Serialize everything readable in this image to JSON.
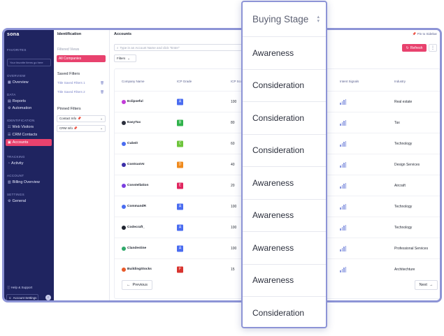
{
  "sidebar": {
    "logo": "sona",
    "sections": {
      "favorites": "FAVORITES",
      "overview": "OVERVIEW",
      "data": "DATA",
      "identification": "IDENTIFICATION",
      "tracking": "TRACKING",
      "account": "ACCOUNT",
      "settings": "SETTINGS"
    },
    "favorites_placeholder": "Your favorite items go here",
    "items": {
      "overview": "Overview",
      "reports": "Reports",
      "automation": "Automation",
      "web_visitors": "Web Visitors",
      "crm_contacts": "CRM Contacts",
      "accounts": "Accounts",
      "activity": "Activity",
      "billing_overview": "Billing Overview",
      "general": "General"
    },
    "help_support": "Help & Support",
    "account_settings": "Account Settings"
  },
  "panel": {
    "title": "Identification",
    "filtered_views": "Filtered Views",
    "all_companies": "All Companies",
    "saved_filters_title": "Saved Filters",
    "saved_filters": [
      "Title Saved Filters 1",
      "Title Saved Filters 2"
    ],
    "pinned_filters_title": "Pinned Filters",
    "pinned_filters": [
      "Contact Info",
      "CRM Info"
    ]
  },
  "main": {
    "title": "Accounts",
    "pin_sidebar": "Pin to Sidebar",
    "search_placeholder": "Type in an Account Name and click \"Enter\"",
    "filters": "Filters",
    "refresh": "Refresh",
    "more": "⋮",
    "columns": {
      "company_name": "Company Name",
      "icp_grade": "ICP Grade",
      "icp_score": "ICP Score",
      "intent_signals": "Intent Signals",
      "industry": "Industry"
    },
    "rows": [
      {
        "company": "Eclipseful",
        "grade": "A",
        "score": "100",
        "industry": "Real estate"
      },
      {
        "company": "EasyTax",
        "grade": "B",
        "score": "80",
        "industry": "Tax"
      },
      {
        "company": "Cubeit",
        "grade": "C",
        "score": "60",
        "industry": "Technology"
      },
      {
        "company": "ContrastAI",
        "grade": "D",
        "score": "40",
        "industry": "Design Services"
      },
      {
        "company": "Constellation",
        "grade": "E",
        "score": "20",
        "industry": "Aircraft"
      },
      {
        "company": "CommandR",
        "grade": "A",
        "score": "100",
        "industry": "Technology"
      },
      {
        "company": "Codecraft_",
        "grade": "A",
        "score": "100",
        "industry": "Technology"
      },
      {
        "company": "Clandestine",
        "grade": "A",
        "score": "100",
        "industry": "Professional Services"
      },
      {
        "company": "BuildingStocks",
        "grade": "F",
        "score": "15",
        "industry": "Architechture"
      }
    ],
    "previous": "Previous",
    "next": "Next"
  },
  "overlay": {
    "header": "Buying Stage",
    "values": [
      "Awareness",
      "Consideration",
      "Consideration",
      "Consideration",
      "Awareness",
      "Awareness",
      "Awareness",
      "Awareness",
      "Consideration"
    ]
  },
  "colors": {
    "sidebar_bg": "#1f2460",
    "accent": "#e8426e",
    "frame_border": "#8d94d6",
    "grade_A": "#4a6cf0",
    "grade_B": "#2fb24a",
    "grade_C": "#6cc43a",
    "grade_D": "#f08a1c",
    "grade_E": "#e0245e",
    "grade_F": "#d8332e"
  },
  "company_logo_colors": [
    "#c23bd8",
    "#2b2f3c",
    "#4a6cf0",
    "#3b2fa8",
    "#7b3fe0",
    "#4a6cf0",
    "#1f2430",
    "#2fa86a",
    "#e85a2a"
  ]
}
